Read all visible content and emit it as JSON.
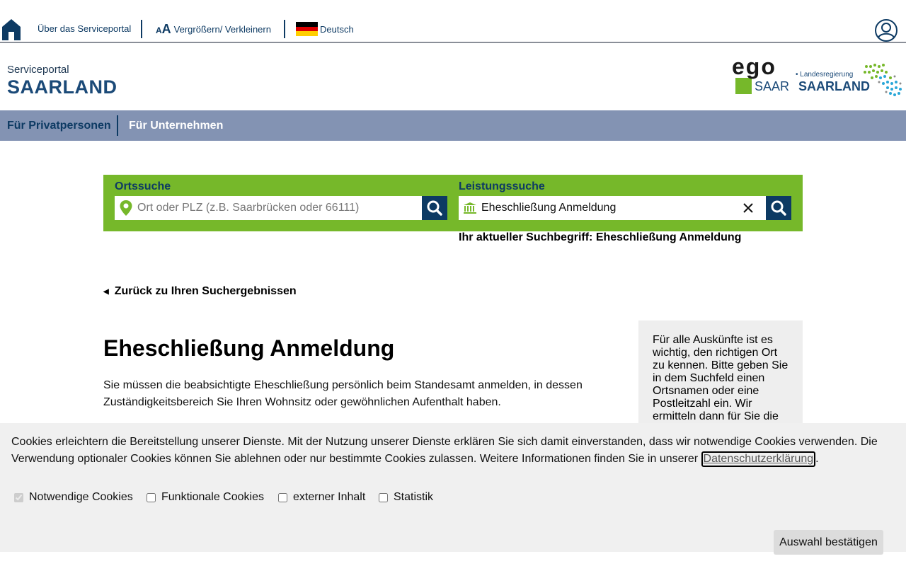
{
  "topbar": {
    "about": "Über das Serviceportal",
    "zoom": "Vergrößern/ Verkleinern",
    "language": "Deutsch"
  },
  "header": {
    "logo_small": "Serviceportal",
    "logo_big": "SAARLAND",
    "partner_small": "Landesregierung",
    "partner_big": "SAARLAND",
    "ego_top": "ego",
    "ego_bottom": "SAAR"
  },
  "nav": {
    "items": [
      {
        "label": "Für Privatpersonen"
      },
      {
        "label": "Für Unternehmen"
      }
    ]
  },
  "search": {
    "place_label": "Ortssuche",
    "place_placeholder": "Ort oder PLZ (z.B. Saarbrücken oder 66111)",
    "service_label": "Leistungssuche",
    "service_value": "Eheschließung Anmeldung",
    "current_term": "Ihr aktueller Suchbegriff: Eheschließung Anmeldung"
  },
  "content": {
    "back": "Zurück zu Ihren Suchergebnissen",
    "title": "Eheschließung Anmeldung",
    "description": "Sie müssen die beabsichtigte Eheschließung persönlich beim Standesamt anmelden, in dessen Zuständigkeitsbereich Sie Ihren Wohnsitz oder gewöhnlichen Aufenthalt haben.",
    "sidebox": "Für alle Auskünfte ist es wichtig, den richtigen Ort zu kennen. Bitte geben Sie in dem Suchfeld einen Ortsnamen oder eine Postleitzahl ein. Wir ermitteln dann für Sie die"
  },
  "cookie": {
    "text": "Cookies erleichtern die Bereitstellung unserer Dienste. Mit der Nutzung unserer Dienste erklären Sie sich damit einverstanden, dass wir notwendige Cookies verwenden. Die Verwendung optionaler Cookies können Sie ablehnen oder nur bestimmte Cookies zulassen. Weitere Informationen finden Sie in unserer ",
    "link": "Datenschutzerklärung",
    "after": ".",
    "options": [
      {
        "label": "Notwendige Cookies",
        "checked": true,
        "disabled": true
      },
      {
        "label": "Funktionale Cookies",
        "checked": false
      },
      {
        "label": "externer Inhalt",
        "checked": false
      },
      {
        "label": "Statistik",
        "checked": false
      }
    ],
    "confirm": "Auswahl bestätigen"
  },
  "colors": {
    "navy": "#0d3a63",
    "green": "#76b82a",
    "nav_bg": "#8393b3"
  }
}
